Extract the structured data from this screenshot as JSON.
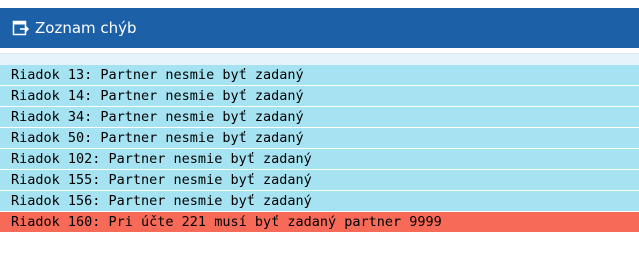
{
  "header": {
    "title": "Zoznam chýb",
    "icon": "exit-window-icon",
    "color": "#1c60a8"
  },
  "messages": [
    {
      "type": "info",
      "text": "Riadok 13: Partner nesmie byť zadaný"
    },
    {
      "type": "info",
      "text": "Riadok 14: Partner nesmie byť zadaný"
    },
    {
      "type": "info",
      "text": "Riadok 34: Partner nesmie byť zadaný"
    },
    {
      "type": "info",
      "text": "Riadok 50: Partner nesmie byť zadaný"
    },
    {
      "type": "info",
      "text": "Riadok 102: Partner nesmie byť zadaný"
    },
    {
      "type": "info",
      "text": "Riadok 155: Partner nesmie byť zadaný"
    },
    {
      "type": "info",
      "text": "Riadok 156: Partner nesmie byť zadaný"
    },
    {
      "type": "error",
      "text": "Riadok 160: Pri účte 221 musí byť zadaný partner 9999"
    }
  ],
  "colors": {
    "info_row": "#a6e3f2",
    "error_row": "#f66a57"
  }
}
